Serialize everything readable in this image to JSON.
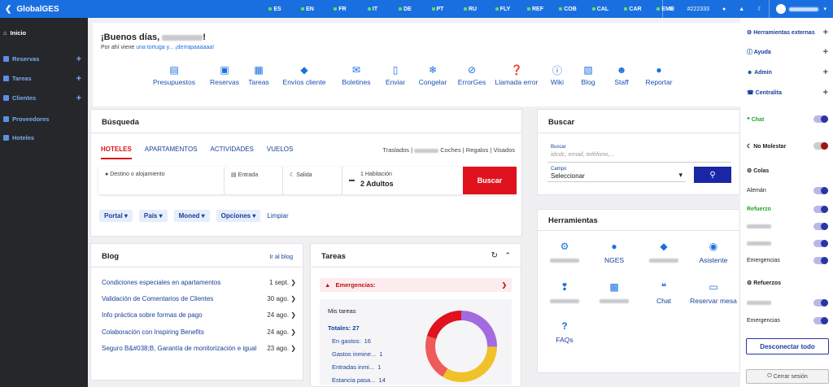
{
  "topbar": {
    "brand": "GlobalGES",
    "languages": [
      "ES",
      "EN",
      "FR",
      "IT",
      "DE",
      "PT",
      "RU",
      "FLY",
      "REF",
      "COB",
      "CAL",
      "CAR",
      "EME"
    ],
    "ticket": "#222333",
    "accent": "#1a6fe0"
  },
  "sidebar": {
    "items": [
      {
        "label": "Inicio"
      },
      {
        "label": "Reservas"
      },
      {
        "label": "Tareas"
      },
      {
        "label": "Clientes"
      },
      {
        "label": "Proveedores"
      },
      {
        "label": "Hoteles"
      }
    ]
  },
  "greeting": {
    "prefix": "¡Buenos días,",
    "suffix": "!",
    "sub_text": "Por ahí viene ",
    "sub_link": "una tortuga y... ¡derrapaaaaaa!"
  },
  "quick_links": [
    "Presupuestos",
    "Reservas",
    "Tareas",
    "Envíos cliente",
    "Boletines",
    "Enviar",
    "Congelar",
    "ErrorGes",
    "Llamada error",
    "Wiki",
    "Blog",
    "Staff",
    "Reportar"
  ],
  "busqueda": {
    "title": "Búsqueda",
    "tabs": [
      "HOTELES",
      "APARTAMENTOS",
      "ACTIVIDADES",
      "VUELOS"
    ],
    "extra_prefix": "Traslados |",
    "extra_suffix": "Coches | Regalos | Visados",
    "destino_placeholder": "Destino o alojamiento",
    "entrada_label": "Entrada",
    "salida_label": "Salida",
    "rooms_label": "1 Habitación",
    "adults_value": "2 Adultos",
    "search_button": "Buscar",
    "filters": [
      "Portal",
      "País",
      "Moned",
      "Opciones"
    ],
    "clear": "Limpiar"
  },
  "buscar": {
    "title": "Buscar",
    "search_label": "Buscar",
    "search_placeholder": "idcdc, email, teléfono,...",
    "campo_label": "Campo",
    "campo_value": "Seleccionar"
  },
  "blog": {
    "title": "Blog",
    "link": "Ir al blog",
    "rows": [
      {
        "title": "Condiciones especiales en apartamentos",
        "date": "1 sept."
      },
      {
        "title": "Validación de Comentarios de Clientes",
        "date": "30 ago."
      },
      {
        "title": "Info práctica sobre formas de pago",
        "date": "24 ago."
      },
      {
        "title": "Colaboración con Inspiring Benefits",
        "date": "24 ago."
      },
      {
        "title": "Seguro B&#038;B, Garantía de monitorización e igual...",
        "date": "23 ago."
      }
    ]
  },
  "tareas": {
    "title": "Tareas",
    "alert": "Emergencias:",
    "mis_title": "Mis tareas",
    "totales": "Totales: 27",
    "items": [
      {
        "label": "En gastos:",
        "value": "16"
      },
      {
        "label": "Gastos inmine...",
        "value": "1"
      },
      {
        "label": "Entradas inmi...",
        "value": "1"
      },
      {
        "label": "Estancia pasa...",
        "value": "14"
      }
    ],
    "donut_colors": [
      "#a26be0",
      "#f0c22a",
      "#e0121e",
      "#ef5a5a"
    ]
  },
  "herramientas": {
    "title": "Herramientas",
    "tools": [
      {
        "label": ""
      },
      {
        "label": "NGES"
      },
      {
        "label": ""
      },
      {
        "label": "Asistente"
      },
      {
        "label": ""
      },
      {
        "label": ""
      },
      {
        "label": "Chat"
      },
      {
        "label": "Reservar mesa"
      },
      {
        "label": "FAQs"
      }
    ]
  },
  "rightbar": {
    "herramientas_externas": "Herramientas externas",
    "ayuda": "Ayuda",
    "admin": "Admin",
    "centralita": "Centralita",
    "chat": "Chat",
    "no_molestar": "No Molestar",
    "colas": "Colas",
    "aleman": "Alemán",
    "refuerzo": "Refuerzo",
    "emergencias1": "Emergencias",
    "refuerzos": "Refuerzos",
    "emergencias2": "Emergencias",
    "disconnect": "Desconectar todo",
    "logout": "Cerrar sesión"
  }
}
